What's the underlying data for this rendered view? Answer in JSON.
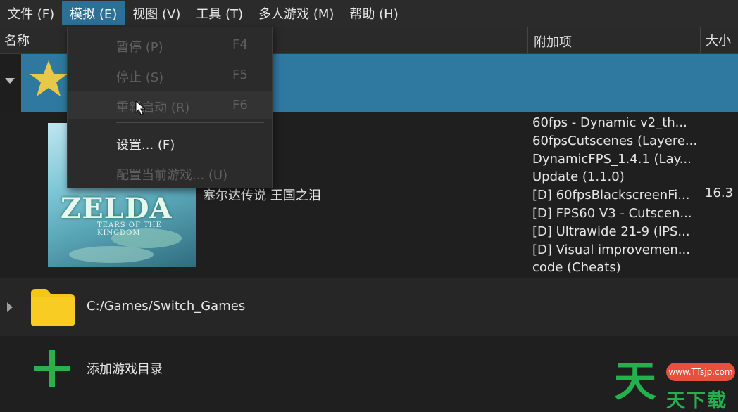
{
  "menubar": {
    "items": [
      {
        "label": "文件 (F)"
      },
      {
        "label": "模拟 (E)"
      },
      {
        "label": "视图 (V)"
      },
      {
        "label": "工具 (T)"
      },
      {
        "label": "多人游戏 (M)"
      },
      {
        "label": "帮助 (H)"
      }
    ]
  },
  "columns": {
    "name": "名称",
    "addons": "附加项",
    "size": "大小"
  },
  "dropdown": {
    "items": [
      {
        "label": "暂停 (P)",
        "shortcut": "F4"
      },
      {
        "label": "停止 (S)",
        "shortcut": "F5"
      },
      {
        "label": "重新启动 (R)",
        "shortcut": "F6"
      },
      {
        "label": "设置... (F)",
        "shortcut": ""
      },
      {
        "label": "配置当前游戏... (U)",
        "shortcut": ""
      }
    ]
  },
  "game": {
    "title": "塞尔达传说 王国之泪",
    "cover_logo": "ZELDA",
    "cover_sub": "TEARS OF THE KINGDOM",
    "size": "16.3",
    "addons": [
      "60fps - Dynamic v2_th...",
      "60fpsCutscenes (Layere...",
      "DynamicFPS_1.4.1 (Lay...",
      "Update (1.1.0)",
      "[D] 60fpsBlackscreenFi...",
      "[D] FPS60 V3 - Cutscen...",
      "[D] Ultrawide 21-9 (IPS...",
      "[D] Visual improvemen...",
      "code (Cheats)"
    ]
  },
  "directory": {
    "path": "C:/Games/Switch_Games"
  },
  "add_directory": {
    "label": "添加游戏目录"
  },
  "watermark": {
    "url": "www.TTsjp.com",
    "big": "天",
    "small": "天下载"
  },
  "colors": {
    "selection": "#2f79a0",
    "menu_active": "#2e6f96",
    "star": "#e8c84a",
    "folder": "#f5c518",
    "plus": "#2db04b"
  }
}
